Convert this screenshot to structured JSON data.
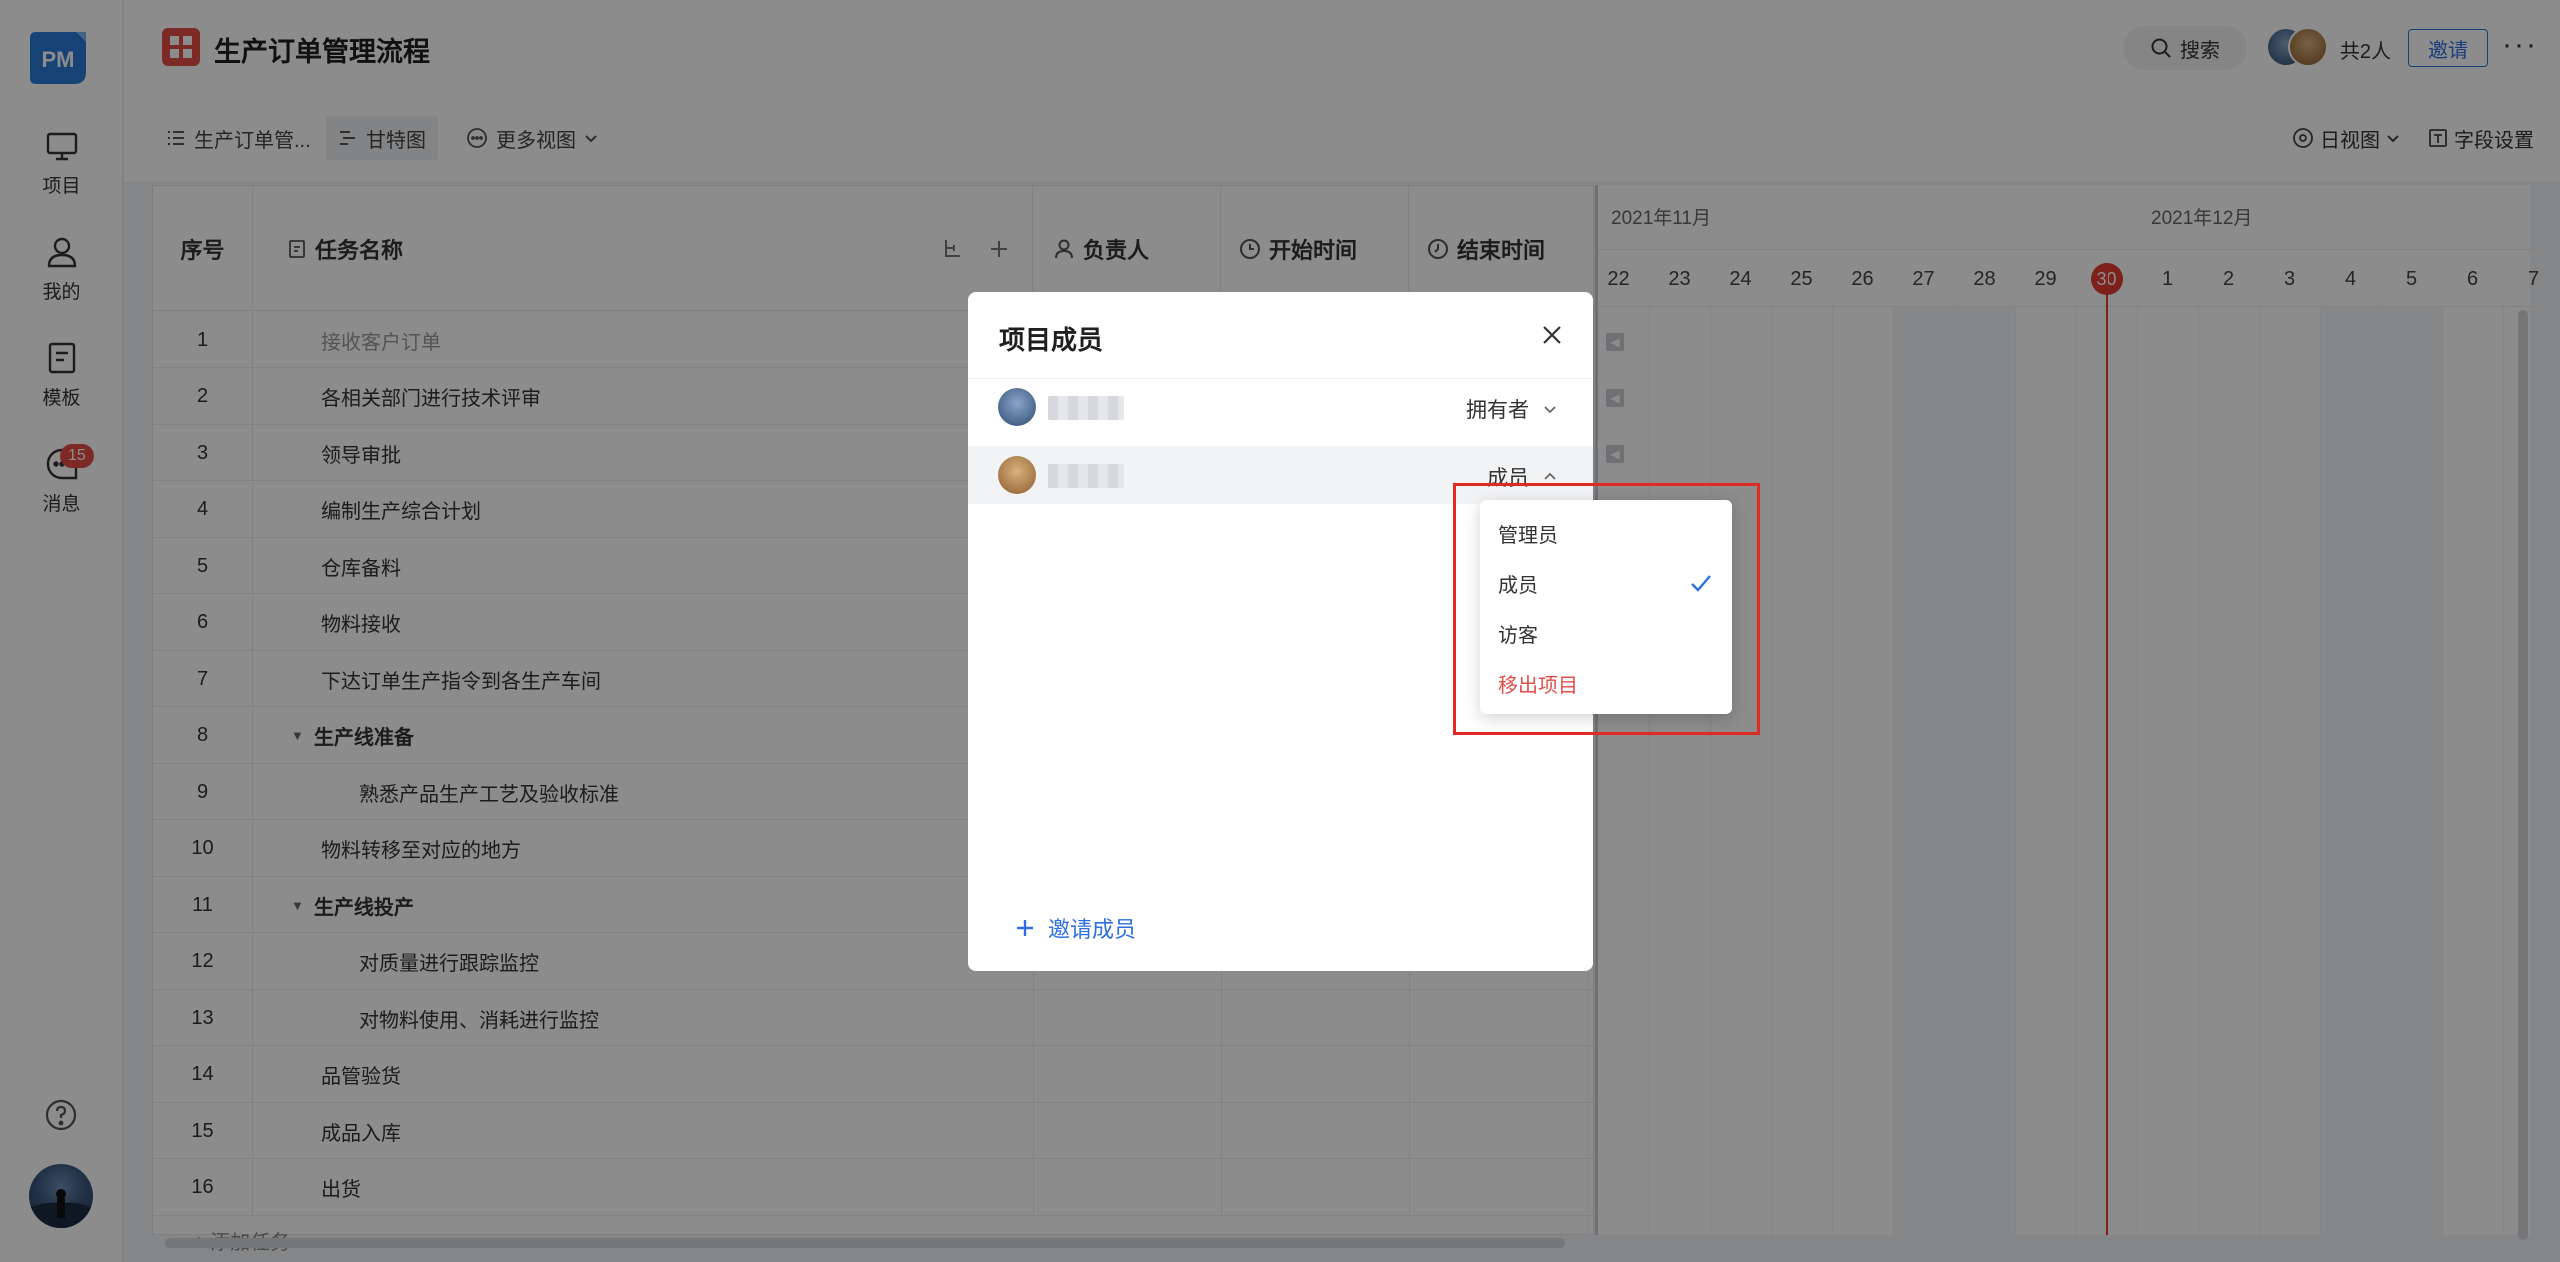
{
  "sidebar": {
    "logo_text": "PM",
    "items": [
      {
        "label": "项目",
        "icon": "monitor-icon"
      },
      {
        "label": "我的",
        "icon": "user-icon"
      },
      {
        "label": "模板",
        "icon": "template-icon"
      },
      {
        "label": "消息",
        "icon": "message-icon",
        "badge": "15"
      }
    ],
    "help_icon": "help-icon"
  },
  "header": {
    "title": "生产订单管理流程",
    "search_label": "搜索",
    "people_count": "共2人",
    "invite_label": "邀请",
    "more_label": "···"
  },
  "viewbar": {
    "tabs": [
      {
        "label": "生产订单管...",
        "icon": "list-icon"
      },
      {
        "label": "甘特图",
        "icon": "gantt-icon",
        "active": true
      },
      {
        "label": "更多视图",
        "icon": "more-views-icon"
      }
    ],
    "day_view_label": "日视图",
    "field_settings_label": "字段设置"
  },
  "table": {
    "columns": {
      "num": "序号",
      "name": "任务名称",
      "owner": "负责人",
      "start": "开始时间",
      "end": "结束时间"
    },
    "rows": [
      {
        "num": "1",
        "name": "接收客户订单"
      },
      {
        "num": "2",
        "name": "各相关部门进行技术评审"
      },
      {
        "num": "3",
        "name": "领导审批"
      },
      {
        "num": "4",
        "name": "编制生产综合计划"
      },
      {
        "num": "5",
        "name": "仓库备料"
      },
      {
        "num": "6",
        "name": "物料接收"
      },
      {
        "num": "7",
        "name": "下达订单生产指令到各生产车间"
      },
      {
        "num": "8",
        "name": "生产线准备"
      },
      {
        "num": "9",
        "name": "熟悉产品生产工艺及验收标准"
      },
      {
        "num": "10",
        "name": "物料转移至对应的地方"
      },
      {
        "num": "11",
        "name": "生产线投产"
      },
      {
        "num": "12",
        "name": "对质量进行跟踪监控"
      },
      {
        "num": "13",
        "name": "对物料使用、消耗进行监控"
      },
      {
        "num": "14",
        "name": "品管验货"
      },
      {
        "num": "15",
        "name": "成品入库"
      },
      {
        "num": "16",
        "name": "出货"
      }
    ],
    "add_task_label": "+ 添加任务"
  },
  "gantt": {
    "months": [
      "2021年11月",
      "2021年12月"
    ],
    "days": [
      "22",
      "23",
      "24",
      "25",
      "26",
      "27",
      "28",
      "29",
      "30",
      "1",
      "2",
      "3",
      "4",
      "5",
      "6",
      "7"
    ],
    "today": "30"
  },
  "dialog": {
    "title": "项目成员",
    "members": [
      {
        "role": "拥有者"
      },
      {
        "role": "成员"
      }
    ],
    "invite_member_label": "邀请成员"
  },
  "role_dropdown": {
    "options": [
      "管理员",
      "成员",
      "访客"
    ],
    "selected": "成员",
    "remove_label": "移出项目"
  },
  "colors": {
    "accent": "#2f6fe4",
    "danger": "#e34d48",
    "highlight": "#e02a26"
  }
}
